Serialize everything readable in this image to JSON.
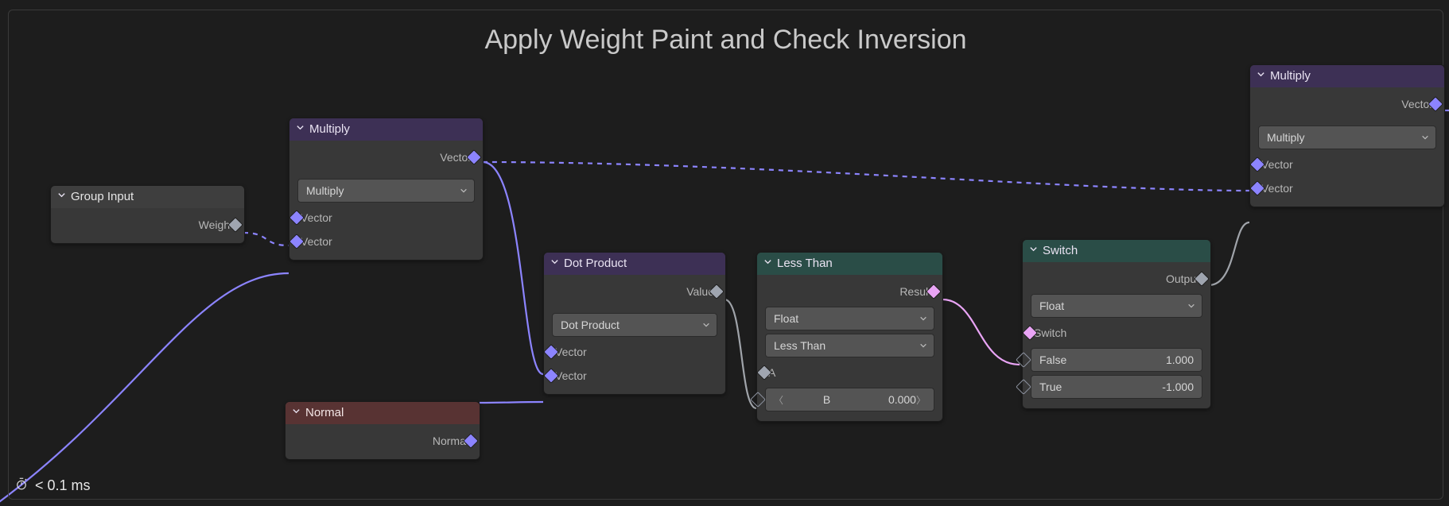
{
  "frame": {
    "title": "Apply Weight Paint and Check Inversion"
  },
  "timing": "< 0.1 ms",
  "nodes": {
    "group_input": {
      "title": "Group Input",
      "outputs": [
        "Weight"
      ]
    },
    "multiply1": {
      "title": "Multiply",
      "operation": "Multiply",
      "outputs": [
        "Vector"
      ],
      "inputs": [
        "Vector",
        "Vector"
      ]
    },
    "normal": {
      "title": "Normal",
      "outputs": [
        "Normal"
      ]
    },
    "dot": {
      "title": "Dot Product",
      "operation": "Dot Product",
      "outputs": [
        "Value"
      ],
      "inputs": [
        "Vector",
        "Vector"
      ]
    },
    "less": {
      "title": "Less Than",
      "type": "Float",
      "operation": "Less Than",
      "outputs": [
        "Result"
      ],
      "inputs": [
        "A"
      ],
      "b_label": "B",
      "b_value": "0.000"
    },
    "switch": {
      "title": "Switch",
      "type": "Float",
      "outputs": [
        "Output"
      ],
      "switch_label": "Switch",
      "false_label": "False",
      "false_value": "1.000",
      "true_label": "True",
      "true_value": "-1.000"
    },
    "multiply2": {
      "title": "Multiply",
      "operation": "Multiply",
      "outputs": [
        "Vector"
      ],
      "inputs": [
        "Vector",
        "Vector"
      ]
    }
  }
}
